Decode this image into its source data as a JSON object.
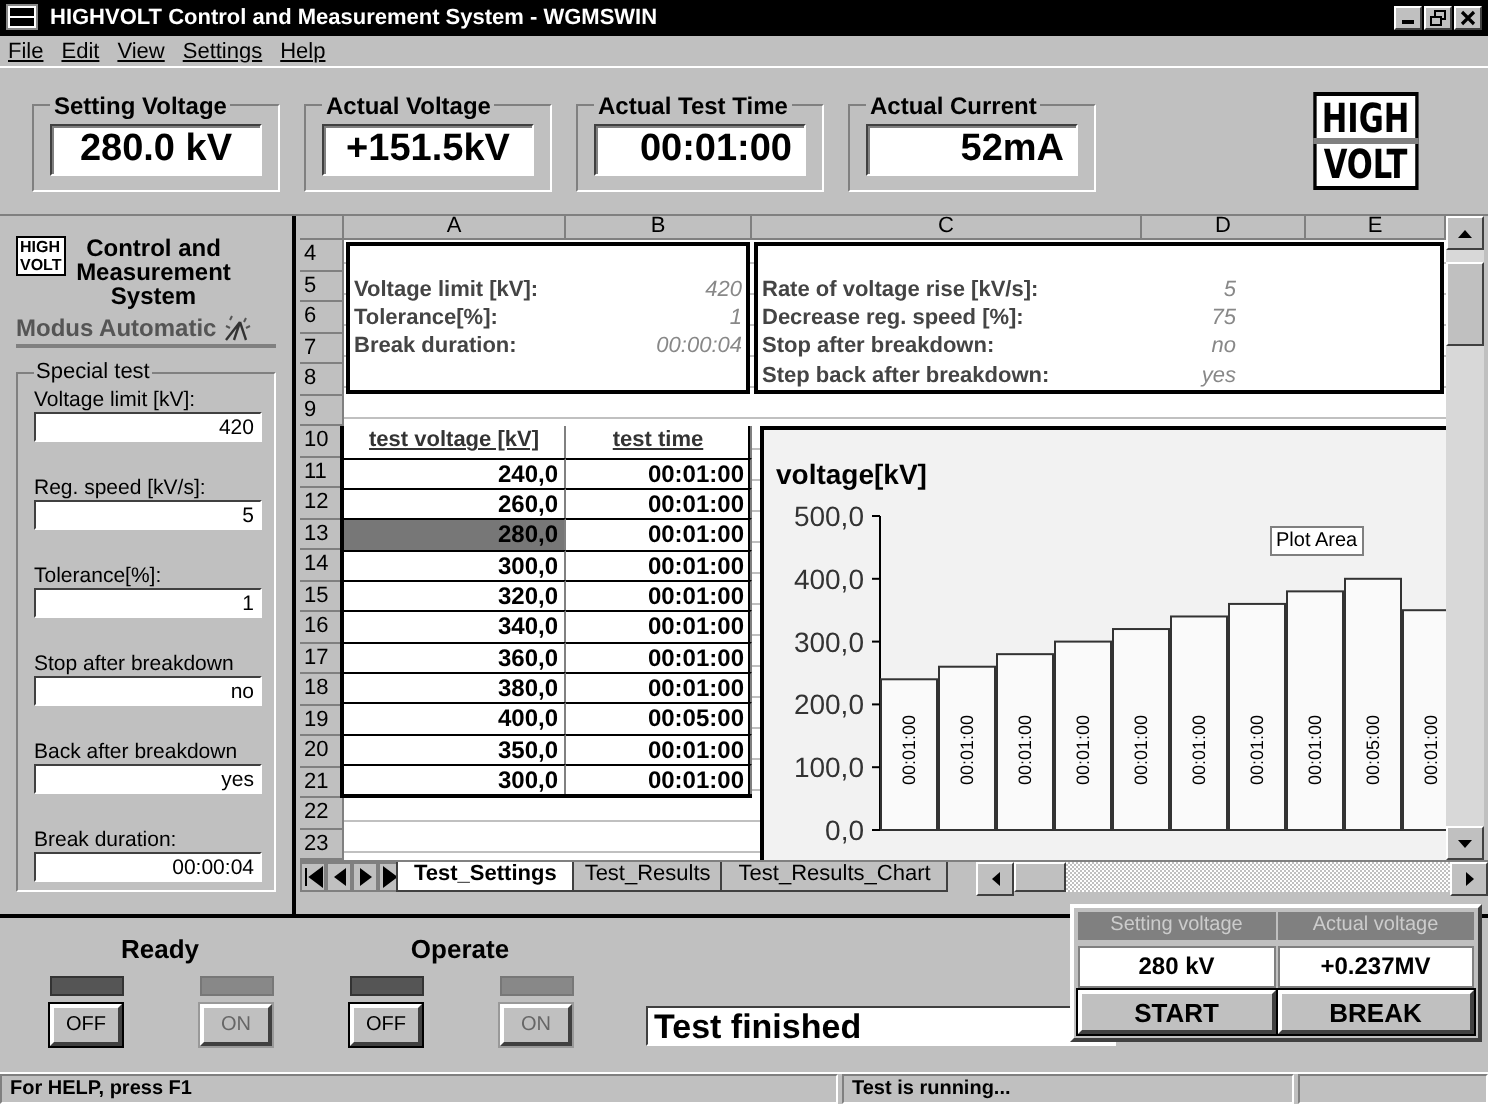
{
  "window": {
    "title": "HIGHVOLT Control and Measurement System - WGMSWIN"
  },
  "menu": [
    "File",
    "Edit",
    "View",
    "Settings",
    "Help"
  ],
  "readouts": [
    {
      "label": "Setting Voltage",
      "value": "280.0 kV"
    },
    {
      "label": "Actual Voltage",
      "value": "+151.5kV"
    },
    {
      "label": "Actual Test Time",
      "value": "00:01:00"
    },
    {
      "label": "Actual Current",
      "value": "52mA"
    }
  ],
  "logo": {
    "top": "HIGH",
    "bottom": "VOLT"
  },
  "side_panel": {
    "logo": {
      "top": "HIGH",
      "bottom": "VOLT"
    },
    "title": "Control and Measurement System",
    "mode": "Modus Automatic",
    "group": "Special test",
    "fields": [
      {
        "label": "Voltage limit [kV]:",
        "value": "420"
      },
      {
        "label": "Reg. speed [kV/s]:",
        "value": "5"
      },
      {
        "label": "Tolerance[%]:",
        "value": "1"
      },
      {
        "label": "Stop after breakdown",
        "value": "no"
      },
      {
        "label": "Back after breakdown",
        "value": "yes"
      },
      {
        "label": "Break duration:",
        "value": "00:00:04"
      }
    ]
  },
  "sheet": {
    "columns": [
      "A",
      "B",
      "C",
      "D",
      "E"
    ],
    "row_numbers": [
      "4",
      "5",
      "6",
      "7",
      "8",
      "9",
      "10",
      "11",
      "12",
      "13",
      "14",
      "15",
      "16",
      "17",
      "18",
      "19",
      "20",
      "21",
      "22",
      "23"
    ],
    "params_left": [
      {
        "label": "Voltage limit [kV]:",
        "value": "420"
      },
      {
        "label": "Tolerance[%]:",
        "value": "1"
      },
      {
        "label": "Break duration:",
        "value": "00:00:04"
      }
    ],
    "params_right": [
      {
        "label": "Rate of voltage rise [kV/s]:",
        "value": "5"
      },
      {
        "label": "Decrease reg. speed [%]:",
        "value": "75"
      },
      {
        "label": "Stop after breakdown:",
        "value": "no"
      },
      {
        "label": "Step back after breakdown:",
        "value": "yes"
      }
    ],
    "table": {
      "columns": [
        "test voltage [kV]",
        "test time"
      ],
      "rows": [
        {
          "voltage": "240,0",
          "time": "00:01:00",
          "selected": false
        },
        {
          "voltage": "260,0",
          "time": "00:01:00",
          "selected": false
        },
        {
          "voltage": "280,0",
          "time": "00:01:00",
          "selected": true
        },
        {
          "voltage": "300,0",
          "time": "00:01:00",
          "selected": false
        },
        {
          "voltage": "320,0",
          "time": "00:01:00",
          "selected": false
        },
        {
          "voltage": "340,0",
          "time": "00:01:00",
          "selected": false
        },
        {
          "voltage": "360,0",
          "time": "00:01:00",
          "selected": false
        },
        {
          "voltage": "380,0",
          "time": "00:01:00",
          "selected": false
        },
        {
          "voltage": "400,0",
          "time": "00:05:00",
          "selected": false
        },
        {
          "voltage": "350,0",
          "time": "00:01:00",
          "selected": false
        },
        {
          "voltage": "300,0",
          "time": "00:01:00",
          "selected": false
        }
      ]
    },
    "chart_data": {
      "type": "bar",
      "title": "voltage[kV]",
      "values": [
        240,
        260,
        280,
        300,
        320,
        340,
        360,
        380,
        400,
        350
      ],
      "categories": [
        "00:01:00",
        "00:01:00",
        "00:01:00",
        "00:01:00",
        "00:01:00",
        "00:01:00",
        "00:01:00",
        "00:01:00",
        "00:05:00",
        "00:01:00"
      ],
      "ylim": [
        0,
        500
      ],
      "yticks": [
        {
          "value": 0,
          "label": "0,0"
        },
        {
          "value": 100,
          "label": "100,0"
        },
        {
          "value": 200,
          "label": "200,0"
        },
        {
          "value": 300,
          "label": "300,0"
        },
        {
          "value": 400,
          "label": "400,0"
        },
        {
          "value": 500,
          "label": "500,0"
        }
      ],
      "annotations": [
        "Plot Area"
      ]
    },
    "tabs": [
      {
        "label": "Test_Settings",
        "selected": true
      },
      {
        "label": "Test_Results",
        "selected": false
      },
      {
        "label": "Test_Results_Chart",
        "selected": false
      }
    ]
  },
  "bottom": {
    "groups": [
      {
        "title": "Ready",
        "buttons": [
          {
            "label": "OFF",
            "disabled": false
          },
          {
            "label": "ON",
            "disabled": true
          }
        ]
      },
      {
        "title": "Operate",
        "buttons": [
          {
            "label": "OFF",
            "disabled": false
          },
          {
            "label": "ON",
            "disabled": true
          }
        ]
      }
    ],
    "message": "Test finished",
    "mini_panel": {
      "headers": [
        "Setting voltage",
        "Actual voltage"
      ],
      "values": [
        "280 kV",
        "+0.237MV"
      ],
      "buttons": [
        "START",
        "BREAK"
      ]
    }
  },
  "status_bar": [
    "For HELP, press F1",
    "Test is running..."
  ]
}
